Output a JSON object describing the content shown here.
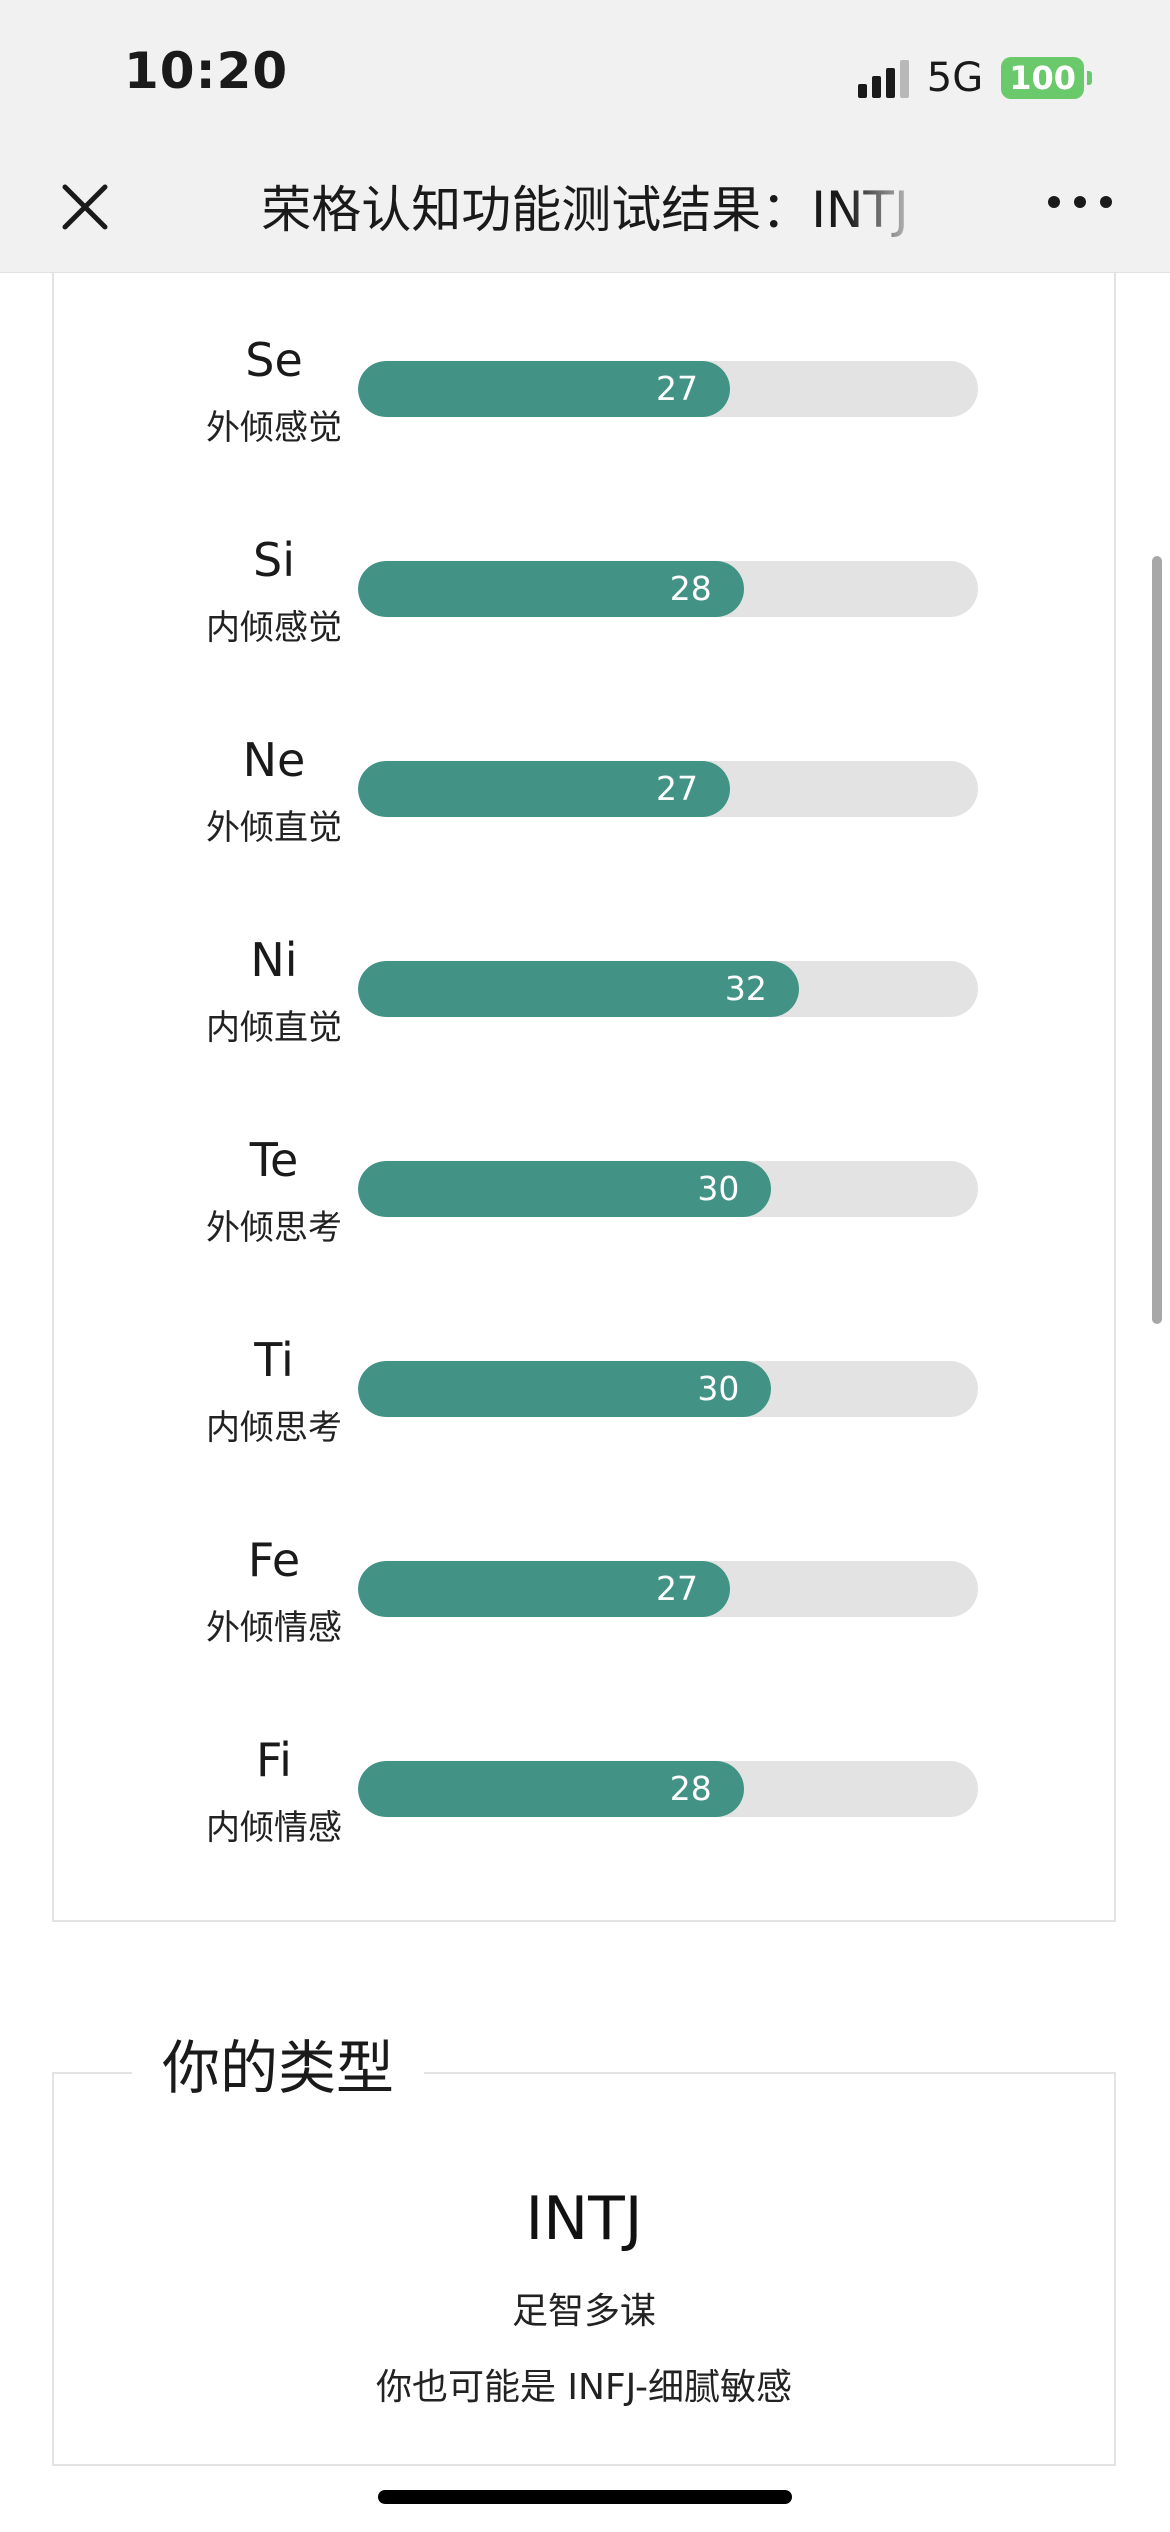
{
  "status_bar": {
    "time": "10:20",
    "network": "5G",
    "battery": "100"
  },
  "nav": {
    "title": "荣格认知功能测试结果：INTJ"
  },
  "chart_data": {
    "type": "bar",
    "categories": [
      "Se",
      "Si",
      "Ne",
      "Ni",
      "Te",
      "Ti",
      "Fe",
      "Fi"
    ],
    "category_names": [
      "外倾感觉",
      "内倾感觉",
      "外倾直觉",
      "内倾直觉",
      "外倾思考",
      "内倾思考",
      "外倾情感",
      "内倾情感"
    ],
    "values": [
      27,
      28,
      27,
      32,
      30,
      30,
      27,
      28
    ],
    "value_labels": [
      "27",
      "28",
      "27",
      "32",
      "30",
      "30",
      "27",
      "28"
    ],
    "orientation": "horizontal",
    "xlim": [
      0,
      45
    ],
    "bar_color": "#429385",
    "track_color": "#e3e3e3",
    "grid": false
  },
  "type_card": {
    "legend": "你的类型",
    "code": "INTJ",
    "nickname": "足智多谋",
    "alternative": "你也可能是 INFJ-细腻敏感"
  },
  "colors": {
    "accent": "#429385",
    "battery": "#6ac96a"
  }
}
